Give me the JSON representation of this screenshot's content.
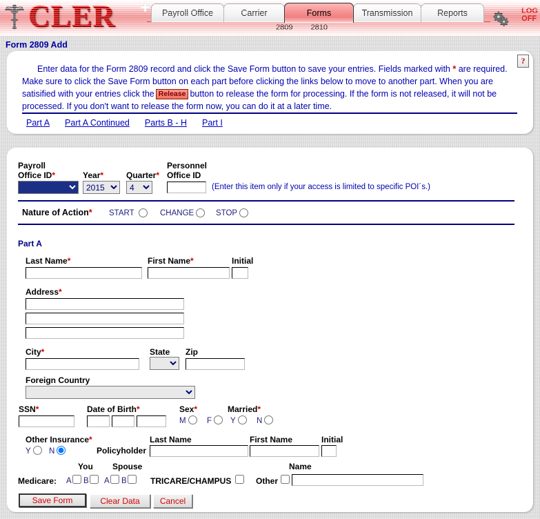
{
  "app": {
    "logo_text": "CLER",
    "logo_icon": "caduceus-icon",
    "logoff_line1": "LOG",
    "logoff_line2": "OFF",
    "gears_icon": "gears-icon"
  },
  "nav": {
    "tabs": [
      {
        "label": "Payroll Office",
        "active": false
      },
      {
        "label": "Carrier",
        "active": false
      },
      {
        "label": "Forms",
        "active": true
      },
      {
        "label": "Transmission",
        "active": false
      },
      {
        "label": "Reports",
        "active": false
      }
    ],
    "sublinks": [
      "2809",
      "2810"
    ]
  },
  "page": {
    "title": "Form 2809 Add",
    "help_icon_label": "?"
  },
  "instructions": {
    "line1": "Enter data for the Form 2809 record and click the Save Form button to save your entries.  Fields marked with",
    "asterisk": "*",
    "line1_tail": "are required.",
    "line2": "Make sure to click the Save Form button on each part before clicking the links below to move to another part.  When you are",
    "line3_pre": "satisified with your entries click the",
    "release_button_label": "Release",
    "line3_post": "button to release the form for processing.  If the form is not released, it will not be",
    "line4": "processed.  If you don't want to release the form now, you can do it at a later time."
  },
  "part_links": [
    "Part A",
    "Part A Continued",
    "Parts B - H",
    "Part I"
  ],
  "office_row": {
    "payroll_office_label_l1": "Payroll",
    "payroll_office_label_l2": "Office ID",
    "payroll_office_value": "",
    "year_label": "Year",
    "year_value": "2015",
    "quarter_label": "Quarter",
    "quarter_value": "4",
    "personnel_office_label_l1": "Personnel",
    "personnel_office_label_l2": "Office ID",
    "personnel_office_value": "",
    "poi_note": "(Enter this item only if your access is limited to specific POI´s.)"
  },
  "nature_of_action": {
    "label": "Nature of Action",
    "options": [
      "START",
      "CHANGE",
      "STOP"
    ],
    "selected": ""
  },
  "part_a": {
    "heading": "Part A",
    "last_name_label": "Last Name",
    "last_name_value": "",
    "first_name_label": "First Name",
    "first_name_value": "",
    "initial_label": "Initial",
    "initial_value": "",
    "address_label": "Address",
    "address_line1": "",
    "address_line2": "",
    "address_line3": "",
    "city_label": "City",
    "city_value": "",
    "state_label": "State",
    "state_value": "",
    "zip_label": "Zip",
    "zip_value": "",
    "foreign_country_label": "Foreign Country",
    "foreign_country_value": "",
    "ssn_label": "SSN",
    "ssn_value": "",
    "dob_label": "Date of Birth",
    "dob_month": "",
    "dob_day": "",
    "dob_year": "",
    "sex_label": "Sex",
    "sex_options": [
      "M",
      "F"
    ],
    "sex_selected": "",
    "married_label": "Married",
    "married_options": [
      "Y",
      "N"
    ],
    "married_selected": ""
  },
  "other_insurance": {
    "label": "Other Insurance",
    "options": [
      "Y",
      "N"
    ],
    "selected": "N",
    "policyholder_label": "Policyholder",
    "last_name_label": "Last Name",
    "last_name_value": "",
    "first_name_label": "First Name",
    "first_name_value": "",
    "initial_label": "Initial",
    "initial_value": "",
    "you_label": "You",
    "spouse_label": "Spouse",
    "medicare_label": "Medicare:",
    "medicare_you_a": "A",
    "medicare_you_b": "B",
    "medicare_spouse_a": "A",
    "medicare_spouse_b": "B",
    "tricare_label": "TRICARE/CHAMPUS",
    "other_label": "Other",
    "name_label": "Name",
    "other_name_value": ""
  },
  "actions": {
    "save_label": "Save Form",
    "clear_label": "Clear Data",
    "cancel_label": "Cancel"
  }
}
